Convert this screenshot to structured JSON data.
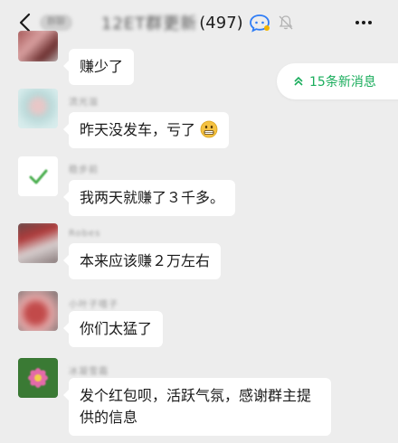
{
  "header": {
    "back_badge": "群聊",
    "title_blurred": "12ET群更新",
    "title_count": "(497)"
  },
  "new_messages": {
    "label": "15条新消息"
  },
  "messages": [
    {
      "nickname": "",
      "text": "赚少了"
    },
    {
      "nickname": "流光溢",
      "text": "昨天没发车，亏了"
    },
    {
      "nickname": "稳步前",
      "text": "我两天就赚了３千多。"
    },
    {
      "nickname": "Robes",
      "text": "本来应该赚２万左右"
    },
    {
      "nickname": "小叶子嘻子",
      "text": "你们太猛了"
    },
    {
      "nickname": "冰凝雪霜",
      "text": "发个红包呗，活跃气氛，感谢群主提供的信息"
    }
  ],
  "colors": {
    "background": "#ededed",
    "bubble": "#ffffff",
    "accent_green": "#1aad5c",
    "text": "#1a1a1a"
  }
}
